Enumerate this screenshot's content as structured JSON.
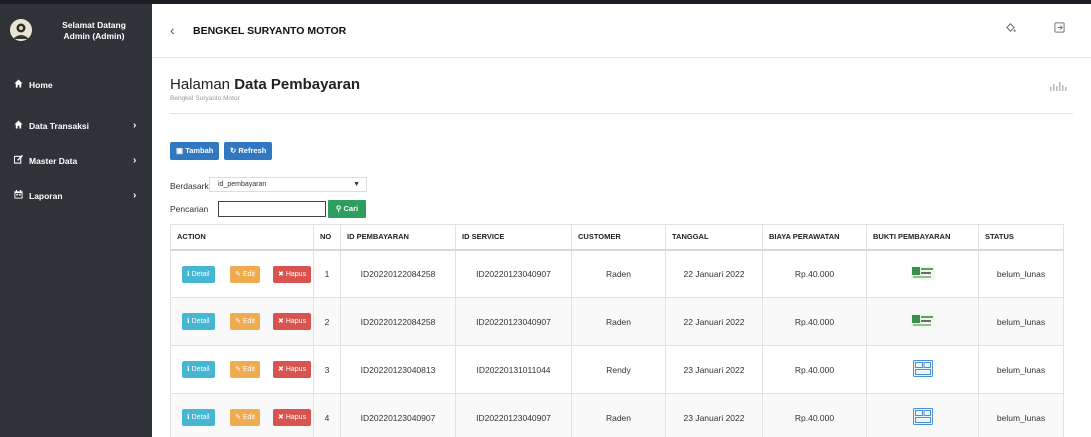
{
  "sidebar": {
    "welcome": "Selamat Datang",
    "user": "Admin (Admin)",
    "items": [
      {
        "icon": "home-icon",
        "label": "Home",
        "has_submenu": false
      },
      {
        "icon": "home-icon",
        "label": "Data Transaksi",
        "has_submenu": true
      },
      {
        "icon": "edit-icon",
        "label": "Master Data",
        "has_submenu": true
      },
      {
        "icon": "calendar-icon",
        "label": "Laporan",
        "has_submenu": true
      }
    ]
  },
  "topbar": {
    "brand": "BENGKEL SURYANTO MOTOR"
  },
  "page": {
    "title_prefix": "Halaman",
    "title_bold": "Data Pembayaran",
    "subtitle": "Bengkel Suryanto Motor"
  },
  "toolbar": {
    "add_label": "Tambah",
    "refresh_label": "Refresh"
  },
  "filter": {
    "by_label": "Berdasarkan:",
    "by_value": "id_pembayaran",
    "search_label": "Pencarian",
    "search_value": "",
    "search_button": "Cari"
  },
  "table": {
    "headers": [
      "ACTION",
      "NO",
      "ID PEMBAYARAN",
      "ID SERVICE",
      "CUSTOMER",
      "TANGGAL",
      "BIAYA PERAWATAN",
      "BUKTI PEMBAYARAN",
      "STATUS"
    ],
    "action_labels": {
      "detail": "Detail",
      "edit": "Edit",
      "hapus": "Hapus"
    },
    "rows": [
      {
        "no": "1",
        "id_pembayaran": "ID20220122084258",
        "id_service": "ID20220123040907",
        "customer": "Raden",
        "tanggal": "22 Januari 2022",
        "biaya": "Rp.40.000",
        "bukti": "receipt-thumbnail",
        "status": "belum_lunas"
      },
      {
        "no": "2",
        "id_pembayaran": "ID20220122084258",
        "id_service": "ID20220123040907",
        "customer": "Raden",
        "tanggal": "22 Januari 2022",
        "biaya": "Rp.40.000",
        "bukti": "receipt-thumbnail",
        "status": "belum_lunas"
      },
      {
        "no": "3",
        "id_pembayaran": "ID20220123040813",
        "id_service": "ID20220131011044",
        "customer": "Rendy",
        "tanggal": "23 Januari 2022",
        "biaya": "Rp.40.000",
        "bukti": "document-thumbnail",
        "status": "belum_lunas"
      },
      {
        "no": "4",
        "id_pembayaran": "ID20220123040907",
        "id_service": "ID20220123040907",
        "customer": "Raden",
        "tanggal": "23 Januari 2022",
        "biaya": "Rp.40.000",
        "bukti": "document-thumbnail",
        "status": "belum_lunas"
      }
    ]
  },
  "colors": {
    "sidebar_bg": "#2f3337",
    "primary": "#3277c1",
    "success": "#2e9e5e",
    "info": "#45b7d3",
    "warning": "#efac4e",
    "danger": "#d9534f"
  }
}
